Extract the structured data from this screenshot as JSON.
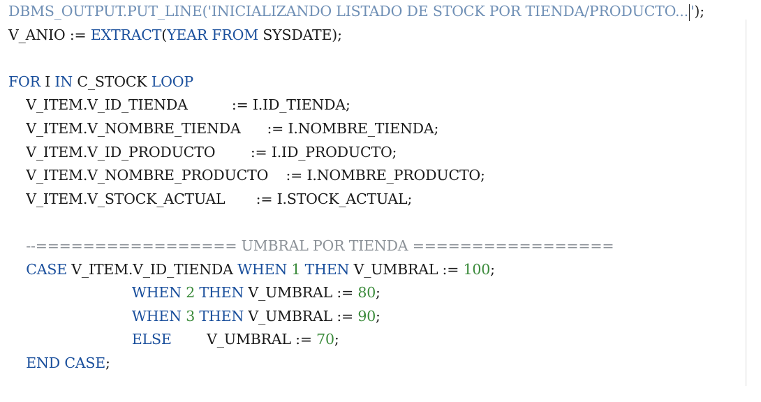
{
  "editor": {
    "lines": [
      {
        "tokens": [
          {
            "t": "DBMS_OUTPUT.PUT_LINE('INICIALIZANDO LISTADO DE STOCK POR TIENDA/PRODUCTO...",
            "c": "string"
          },
          {
            "t": "",
            "c": "cursor"
          },
          {
            "t": "'",
            "c": "string"
          },
          {
            "t": ");",
            "c": "plain"
          }
        ]
      },
      {
        "tokens": [
          {
            "t": "V_ANIO := ",
            "c": "plain"
          },
          {
            "t": "EXTRACT",
            "c": "keyword"
          },
          {
            "t": "(",
            "c": "plain"
          },
          {
            "t": "YEAR FROM",
            "c": "keyword"
          },
          {
            "t": " SYSDATE);",
            "c": "plain"
          }
        ]
      },
      {
        "tokens": []
      },
      {
        "tokens": [
          {
            "t": "FOR",
            "c": "keyword"
          },
          {
            "t": " I ",
            "c": "plain"
          },
          {
            "t": "IN",
            "c": "keyword"
          },
          {
            "t": " C_STOCK ",
            "c": "plain"
          },
          {
            "t": "LOOP",
            "c": "keyword"
          }
        ]
      },
      {
        "tokens": [
          {
            "t": "    V_ITEM.V_ID_TIENDA          := I.ID_TIENDA;",
            "c": "plain"
          }
        ]
      },
      {
        "tokens": [
          {
            "t": "    V_ITEM.V_NOMBRE_TIENDA      := I.NOMBRE_TIENDA;",
            "c": "plain"
          }
        ]
      },
      {
        "tokens": [
          {
            "t": "    V_ITEM.V_ID_PRODUCTO        := I.ID_PRODUCTO;",
            "c": "plain"
          }
        ]
      },
      {
        "tokens": [
          {
            "t": "    V_ITEM.V_NOMBRE_PRODUCTO    := I.NOMBRE_PRODUCTO;",
            "c": "plain"
          }
        ]
      },
      {
        "tokens": [
          {
            "t": "    V_ITEM.V_STOCK_ACTUAL       := I.STOCK_ACTUAL;",
            "c": "plain"
          }
        ]
      },
      {
        "tokens": []
      },
      {
        "tokens": [
          {
            "t": "    --================= UMBRAL POR TIENDA =================",
            "c": "comment"
          }
        ]
      },
      {
        "tokens": [
          {
            "t": "    ",
            "c": "plain"
          },
          {
            "t": "CASE",
            "c": "keyword"
          },
          {
            "t": " V_ITEM.V_ID_TIENDA ",
            "c": "plain"
          },
          {
            "t": "WHEN",
            "c": "keyword"
          },
          {
            "t": " ",
            "c": "plain"
          },
          {
            "t": "1",
            "c": "number"
          },
          {
            "t": " ",
            "c": "plain"
          },
          {
            "t": "THEN",
            "c": "keyword"
          },
          {
            "t": " V_UMBRAL := ",
            "c": "plain"
          },
          {
            "t": "100",
            "c": "number"
          },
          {
            "t": ";",
            "c": "plain"
          }
        ]
      },
      {
        "tokens": [
          {
            "t": "                            ",
            "c": "plain"
          },
          {
            "t": "WHEN",
            "c": "keyword"
          },
          {
            "t": " ",
            "c": "plain"
          },
          {
            "t": "2",
            "c": "number"
          },
          {
            "t": " ",
            "c": "plain"
          },
          {
            "t": "THEN",
            "c": "keyword"
          },
          {
            "t": " V_UMBRAL := ",
            "c": "plain"
          },
          {
            "t": "80",
            "c": "number"
          },
          {
            "t": ";",
            "c": "plain"
          }
        ]
      },
      {
        "tokens": [
          {
            "t": "                            ",
            "c": "plain"
          },
          {
            "t": "WHEN",
            "c": "keyword"
          },
          {
            "t": " ",
            "c": "plain"
          },
          {
            "t": "3",
            "c": "number"
          },
          {
            "t": " ",
            "c": "plain"
          },
          {
            "t": "THEN",
            "c": "keyword"
          },
          {
            "t": " V_UMBRAL := ",
            "c": "plain"
          },
          {
            "t": "90",
            "c": "number"
          },
          {
            "t": ";",
            "c": "plain"
          }
        ]
      },
      {
        "tokens": [
          {
            "t": "                            ",
            "c": "plain"
          },
          {
            "t": "ELSE",
            "c": "keyword"
          },
          {
            "t": "        V_UMBRAL := ",
            "c": "plain"
          },
          {
            "t": "70",
            "c": "number"
          },
          {
            "t": ";",
            "c": "plain"
          }
        ]
      },
      {
        "tokens": [
          {
            "t": "    ",
            "c": "plain"
          },
          {
            "t": "END CASE",
            "c": "keyword"
          },
          {
            "t": ";",
            "c": "plain"
          }
        ]
      }
    ]
  },
  "colors": {
    "keyword": "#1a4f9c",
    "string": "#6f8fb5",
    "comment": "#8c9298",
    "number": "#3a8a3a",
    "plain": "#1a1a1a",
    "background": "#ffffff"
  }
}
